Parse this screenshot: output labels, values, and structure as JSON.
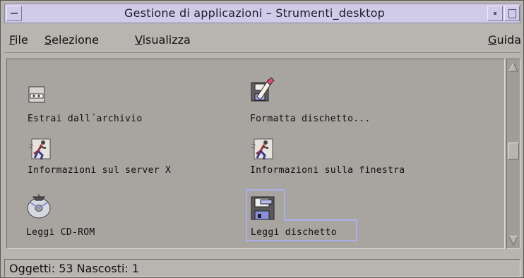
{
  "window": {
    "title": "Gestione di applicazioni – Strumenti_desktop"
  },
  "menubar": {
    "items": [
      {
        "mnemonic": "F",
        "rest": "ile"
      },
      {
        "mnemonic": "S",
        "rest": "elezione"
      },
      {
        "mnemonic": "V",
        "rest": "isualizza"
      },
      {
        "mnemonic": "G",
        "rest": "uida"
      }
    ]
  },
  "icons": [
    {
      "label": "Estrai dall´archivio",
      "icon": "archive-extract-icon"
    },
    {
      "label": "Formatta dischetto...",
      "icon": "format-floppy-icon"
    },
    {
      "label": "Informazioni sul server X",
      "icon": "runner-icon"
    },
    {
      "label": "Informazioni sulla finestra",
      "icon": "runner-icon"
    },
    {
      "label": "Leggi CD-ROM",
      "icon": "cdrom-icon"
    },
    {
      "label": "Leggi dischetto",
      "icon": "floppy-icon",
      "selected": true
    }
  ],
  "status": {
    "text": "Oggetti: 53 Nascosti: 1"
  },
  "colors": {
    "titlebar": "#cfcbe8",
    "workspace": "#a8a4a0",
    "selection": "#a9b0ee"
  }
}
